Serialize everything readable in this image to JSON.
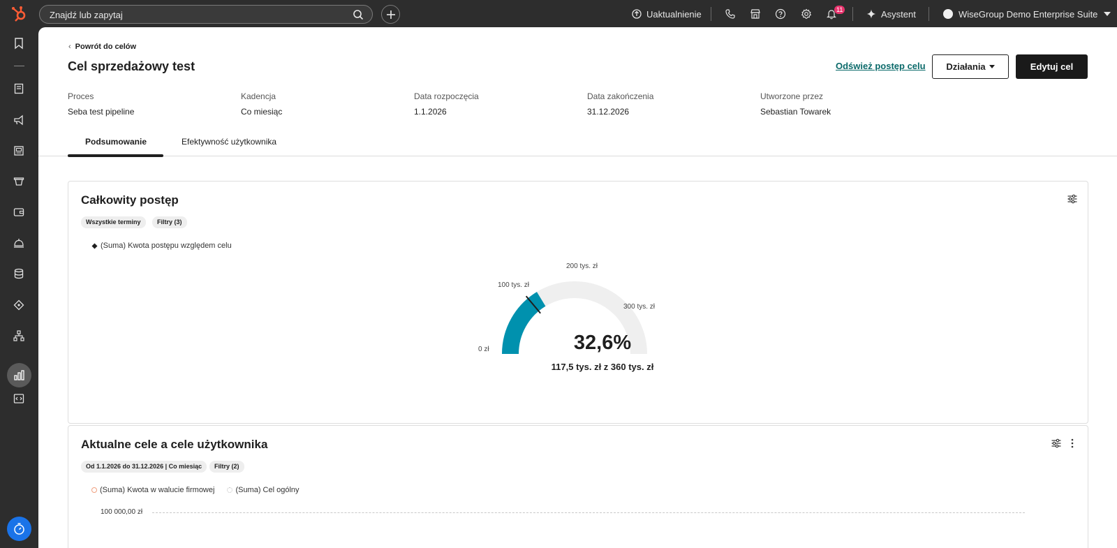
{
  "topbar": {
    "search_placeholder": "Znajdź lub zapytaj",
    "upgrade_label": "Uaktualnienie",
    "notification_count": "11",
    "assistant_label": "Asystent",
    "account_name": "WiseGroup Demo Enterprise Suite"
  },
  "header": {
    "back_label": "Powrót do celów",
    "title": "Cel sprzedażowy test",
    "refresh_label": "Odśwież postęp celu",
    "actions_label": "Działania",
    "edit_label": "Edytuj cel"
  },
  "meta": [
    {
      "label": "Proces",
      "value": "Seba test pipeline"
    },
    {
      "label": "Kadencja",
      "value": "Co miesiąc"
    },
    {
      "label": "Data rozpoczęcia",
      "value": "1.1.2026"
    },
    {
      "label": "Data zakończenia",
      "value": "31.12.2026"
    },
    {
      "label": "Utworzone przez",
      "value": "Sebastian Towarek"
    }
  ],
  "tabs": [
    {
      "label": "Podsumowanie",
      "active": true
    },
    {
      "label": "Efektywność użytkownika",
      "active": false
    }
  ],
  "progress_card": {
    "title": "Całkowity postęp",
    "chips": [
      "Wszystkie terminy",
      "Filtry (3)"
    ],
    "legend": "(Suma) Kwota postępu względem celu",
    "gauge": {
      "percent_label": "32,6%",
      "summary": "117,5 tys. zł z 360 tys. zł",
      "progress_fraction": 0.326,
      "marker_fraction": 0.278,
      "tick_labels": [
        "0 zł",
        "100 tys. zł",
        "200 tys. zł",
        "300 tys. zł"
      ],
      "fill_color": "#0091ae",
      "track_color": "#efefef"
    }
  },
  "goals_card": {
    "title": "Aktualne cele a cele użytkownika",
    "chips": [
      "Od 1.1.2026 do 31.12.2026 | Co miesiąc",
      "Filtry (2)"
    ],
    "legend": [
      "(Suma) Kwota w walucie firmowej",
      "(Suma) Cel ogólny"
    ],
    "y_axis_label": "100 000,00 zł"
  },
  "colors": {
    "accent": "#0091ae",
    "link": "#0b6a6a",
    "brand": "#ff5c35",
    "badge": "#e8336d"
  }
}
